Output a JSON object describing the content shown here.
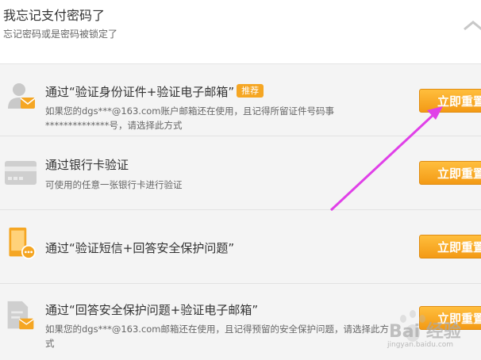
{
  "header": {
    "title": "我忘记支付密码了",
    "subtitle": "忘记密码或是密码被锁定了"
  },
  "options": [
    {
      "title": "通过“验证身份证件+验证电子邮箱”",
      "badge": "推荐",
      "desc": "如果您的dgs***@163.com账户邮箱还在使用，且记得所留证件号码事**************号，请选择此方式",
      "button": "立即重置",
      "icon": "user-mail-icon"
    },
    {
      "title": "通过银行卡验证",
      "desc": "可使用的任意一张银行卡进行验证",
      "button": "立即重置",
      "icon": "bank-card-icon"
    },
    {
      "title": "通过“验证短信+回答安全保护问题”",
      "button": "立即重置",
      "icon": "phone-message-icon"
    },
    {
      "title": "通过“回答安全保护问题+验证电子邮箱”",
      "desc": "如果您的dgs***@163.com邮箱还在使用，且记得预留的安全保护问题，请选择此方式",
      "button": "立即重置",
      "icon": "document-mail-icon"
    }
  ],
  "watermark": {
    "text": "Bai 经验",
    "url": "jingyan.baidu.com"
  },
  "colors": {
    "button": "#f5a623",
    "annotation_arrow": "#e040e8"
  }
}
